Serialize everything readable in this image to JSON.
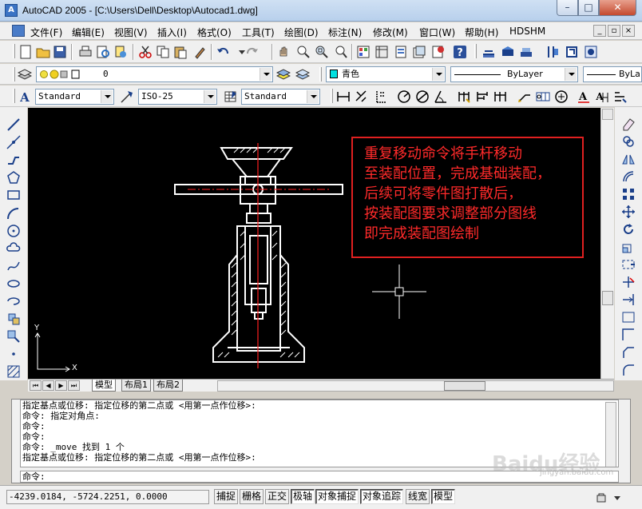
{
  "window": {
    "title": "AutoCAD 2005 - [C:\\Users\\Dell\\Desktop\\Autocad1.dwg]",
    "app_icon_label": "A"
  },
  "menu": {
    "items": [
      "文件(F)",
      "编辑(E)",
      "视图(V)",
      "插入(I)",
      "格式(O)",
      "工具(T)",
      "绘图(D)",
      "标注(N)",
      "修改(M)",
      "窗口(W)",
      "帮助(H)",
      "HDSHM"
    ]
  },
  "layers": {
    "current_layer": "0",
    "color": "青色",
    "color_swatch": "#00e0e0",
    "linetype": "ByLayer",
    "lineweight": "ByLa"
  },
  "styles": {
    "text_style": "Standard",
    "dim_style": "ISO-25",
    "table_style": "Standard"
  },
  "annotation": {
    "lines": [
      "重复移动命令将手杆移动",
      "至装配位置，完成基础装配，",
      "后续可将零件图打散后，",
      "按装配图要求调整部分图线",
      "即完成装配图绘制"
    ],
    "color": "#ff2a2a"
  },
  "ucs": {
    "x_label": "X",
    "y_label": "Y"
  },
  "tabs": {
    "model": "模型",
    "layout1": "布局1",
    "layout2": "布局2"
  },
  "command": {
    "history": [
      "指定基点或位移: 指定位移的第二点或 <用第一点作位移>:",
      "命令: 指定对角点:",
      "命令:",
      "命令:",
      "命令: _move 找到 1 个",
      "指定基点或位移: 指定位移的第二点或 <用第一点作位移>:"
    ],
    "prompt": "命令:"
  },
  "status": {
    "coords": "-4239.0184, -5724.2251, 0.0000",
    "buttons": [
      "捕捉",
      "栅格",
      "正交",
      "极轴",
      "对象捕捉",
      "对象追踪",
      "线宽",
      "模型"
    ],
    "active": [
      false,
      false,
      false,
      true,
      true,
      true,
      false,
      true
    ]
  },
  "watermark": {
    "text": "Baidu经验",
    "sub": "jingyan.baidu.com"
  }
}
